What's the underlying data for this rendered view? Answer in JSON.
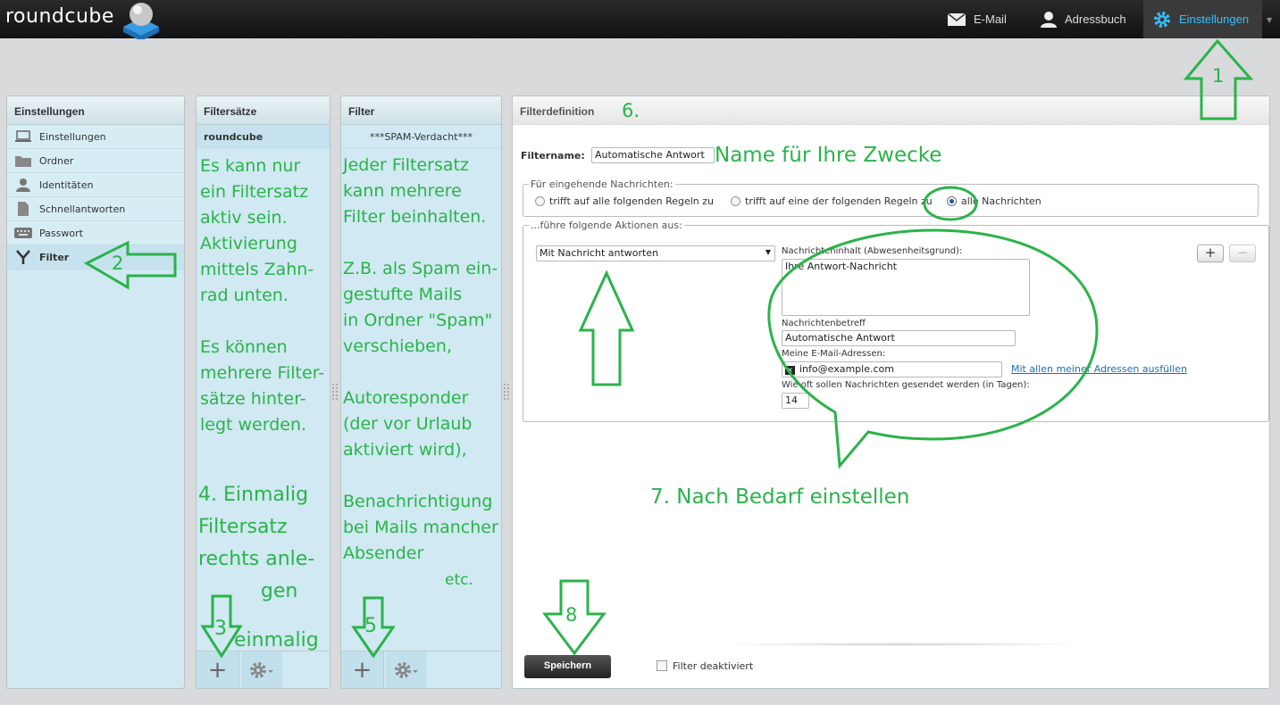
{
  "app": {
    "logo": "roundcube"
  },
  "topnav": {
    "mail": "E-Mail",
    "addressbook": "Adressbuch",
    "settings": "Einstellungen"
  },
  "colors": {
    "accent": "#37beff",
    "annotation": "#2ab34a",
    "panel": "#d0e9f2"
  },
  "settings_panel": {
    "title": "Einstellungen",
    "items": [
      {
        "label": "Einstellungen",
        "icon": "monitor-icon"
      },
      {
        "label": "Ordner",
        "icon": "folder-icon"
      },
      {
        "label": "Identitäten",
        "icon": "person-icon"
      },
      {
        "label": "Schnellantworten",
        "icon": "document-icon"
      },
      {
        "label": "Passwort",
        "icon": "keyboard-icon"
      },
      {
        "label": "Filter",
        "icon": "filter-icon"
      }
    ]
  },
  "filtersets_panel": {
    "title": "Filtersätze",
    "items": [
      "roundcube"
    ]
  },
  "filters_panel": {
    "title": "Filter",
    "items": [
      "***SPAM-Verdacht***"
    ]
  },
  "definition": {
    "title": "Filterdefinition",
    "filtername_label": "Filtername:",
    "filtername_value": "Automatische Antwort",
    "incoming_legend": "Für eingehende Nachrichten:",
    "radio_all_rules": "trifft auf alle folgenden Regeln zu",
    "radio_any_rule": "trifft auf eine der folgenden Regeln zu",
    "radio_all_messages": "alle Nachrichten",
    "actions_legend": "...führe folgende Aktionen aus:",
    "action_select": "Mit Nachricht antworten",
    "body_label": "Nachrichteninhalt (Abwesenheitsgrund):",
    "body_value": "Ihre Antwort-Nachricht",
    "subject_label": "Nachrichtenbetreff",
    "subject_value": "Automatische Antwort",
    "addresses_label": "Meine E-Mail-Adressen:",
    "address_value": "info@example.com",
    "fill_addresses_link": "Mit allen meiner Adressen ausfüllen",
    "days_label": "Wie oft sollen Nachrichten gesendet werden (in Tagen):",
    "days_value": "14",
    "add_btn": "+",
    "remove_btn": "−",
    "save_btn": "Speichern",
    "disabled_label": "Filter deaktiviert"
  },
  "annotations": {
    "n1": "1",
    "n2": "2",
    "n3": "3",
    "n3_text": "einmalig",
    "n4": "4. Einmalig\nFiltersatz\nrechts anle-\n          gen",
    "n5": "5",
    "n6": "6.",
    "n7": "7. Nach Bedarf einstellen",
    "n8": "8",
    "name_hint": "Name für Ihre Zwecke",
    "filterset_text": "Es kann nur\nein Filtersatz\naktiv sein.\nAktivierung\nmittels Zahn-\nrad unten.\n\nEs können\nmehrere Filter-\nsätze hinter-\nlegt werden.",
    "filter_text": "Jeder Filtersatz\nkann mehrere\nFilter beinhalten.\n\nZ.B. als Spam ein-\ngestufte Mails\nin Ordner \"Spam\"\nverschieben,\n\nAutoresponder\n(der vor Urlaub\naktiviert wird),\n\nBenachrichtigung\nbei Mails mancher\nAbsender",
    "etc": "etc."
  }
}
